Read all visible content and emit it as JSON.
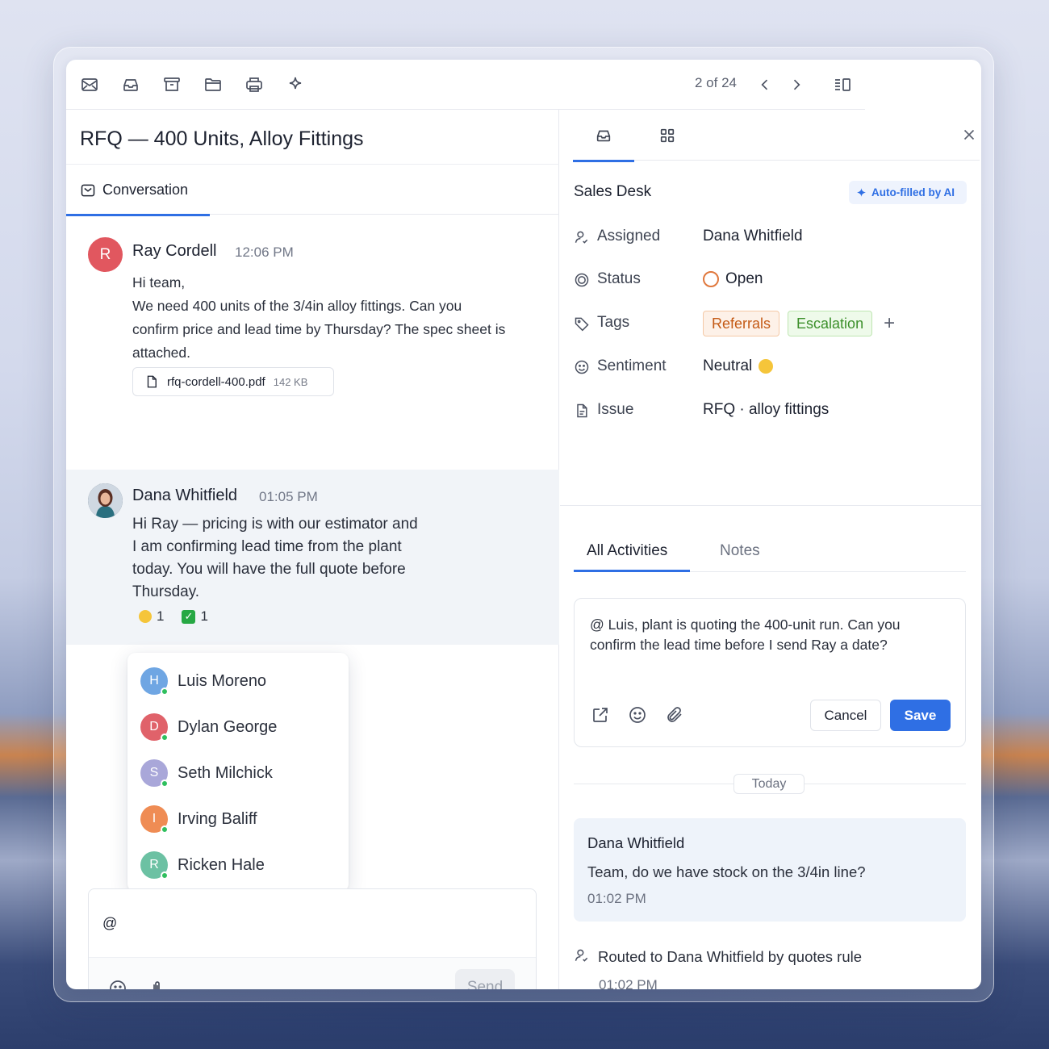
{
  "toolbar": {
    "icons": [
      "mail-icon",
      "inbox-icon",
      "archive-icon",
      "folder-icon",
      "print-icon",
      "sparkle-icon"
    ],
    "pager": "2 of 24"
  },
  "ticket": {
    "title": "RFQ — 400 Units, Alloy Fittings"
  },
  "conversation_tab": {
    "label": "Conversation"
  },
  "messages": [
    {
      "author": "Ray Cordell",
      "initial": "R",
      "avatar_color": "#e1575f",
      "time": "12:06 PM",
      "lines": [
        "Hi team,",
        "We need 400 units of the 3/4in alloy fittings. Can you",
        "confirm price and lead time by Thursday? The spec sheet is",
        "attached."
      ],
      "attachment": {
        "name": "rfq-cordell-400.pdf",
        "size": "142 KB"
      }
    },
    {
      "author": "Dana Whitfield",
      "time": "01:05 PM",
      "lines": [
        "Hi Ray — pricing is with our estimator and",
        "I am confirming lead time from the plant",
        "today. You will have the full quote before",
        "Thursday."
      ],
      "reactions": [
        {
          "emoji": "grinning-face",
          "count": "1"
        },
        {
          "emoji": "check-mark",
          "count": "1"
        }
      ]
    }
  ],
  "mention_list": [
    {
      "initial": "H",
      "name": "Luis Moreno",
      "color": "#6fa6e3"
    },
    {
      "initial": "D",
      "name": "Dylan George",
      "color": "#e0626a"
    },
    {
      "initial": "S",
      "name": "Seth Milchick",
      "color": "#a9a7d9"
    },
    {
      "initial": "I",
      "name": "Irving Baliff",
      "color": "#ef8c54"
    },
    {
      "initial": "R",
      "name": "Ricken Hale",
      "color": "#6cc1a3"
    }
  ],
  "composer": {
    "value": "@",
    "send_label": "Send"
  },
  "sidebar": {
    "section_title": "Sales Desk",
    "ai_badge": "Auto-filled by AI",
    "properties": {
      "assigned": {
        "label": "Assigned",
        "value": "Dana Whitfield"
      },
      "status": {
        "label": "Status",
        "value": "Open"
      },
      "tags": {
        "label": "Tags",
        "values": [
          "Referrals",
          "Escalation"
        ]
      },
      "sentiment": {
        "label": "Sentiment",
        "value": "Neutral"
      },
      "issue": {
        "label": "Issue",
        "value": "RFQ · alloy fittings"
      }
    },
    "activity_tabs": [
      "All Activities",
      "Notes"
    ],
    "note": {
      "text": "@ Luis, plant is quoting the 400-unit run. Can you confirm the lead time before I send Ray a date?",
      "cancel_label": "Cancel",
      "save_label": "Save"
    },
    "today_label": "Today",
    "activities": [
      {
        "author": "Dana Whitfield",
        "body": "Team, do we have stock on the 3/4in line?",
        "time": "01:02 PM"
      }
    ],
    "routed": {
      "text": "Routed to Dana Whitfield by quotes rule",
      "time": "01:02 PM"
    }
  },
  "colors": {
    "accent": "#2f6fe4",
    "status_open": "#e0783d"
  }
}
